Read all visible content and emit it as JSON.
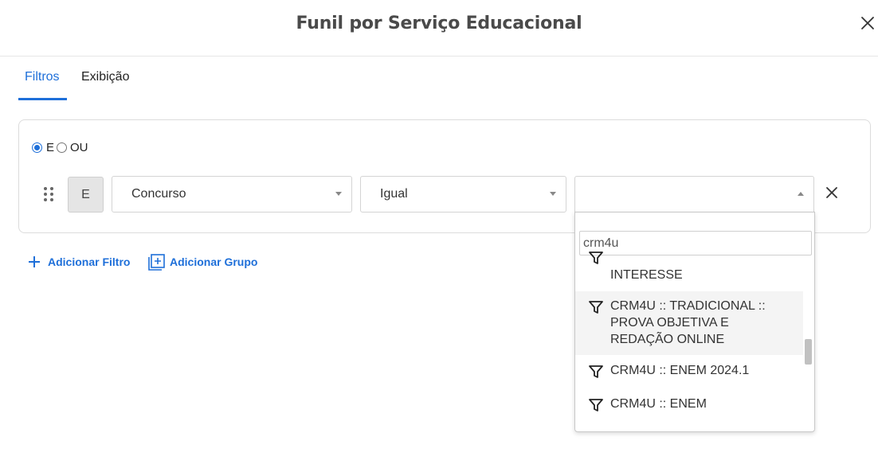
{
  "modal": {
    "title": "Funil por Serviço Educacional"
  },
  "tabs": [
    {
      "label": "Filtros",
      "active": true
    },
    {
      "label": "Exibição",
      "active": false
    }
  ],
  "logic": {
    "options": [
      {
        "label": "E",
        "checked": true
      },
      {
        "label": "OU",
        "checked": false
      }
    ]
  },
  "filter_row": {
    "connector": "E",
    "field": "Concurso",
    "operator": "Igual",
    "value": ""
  },
  "actions": {
    "add_filter": "Adicionar Filtro",
    "add_group": "Adicionar Grupo"
  },
  "dropdown": {
    "search_value": "crm4u",
    "items": [
      {
        "label": "INTERESSE",
        "icon": "filter-icon",
        "partial": true
      },
      {
        "label": "CRM4U :: TRADICIONAL :: PROVA OBJETIVA E REDAÇÃO ONLINE",
        "icon": "filter-icon",
        "highlighted": true
      },
      {
        "label": "CRM4U :: ENEM 2024.1",
        "icon": "filter-icon"
      },
      {
        "label": "CRM4U :: ENEM",
        "icon": "filter-icon"
      }
    ]
  },
  "colors": {
    "accent": "#1e6fd9",
    "title": "#4a4a4a",
    "highlight": "#f4f4f4"
  }
}
